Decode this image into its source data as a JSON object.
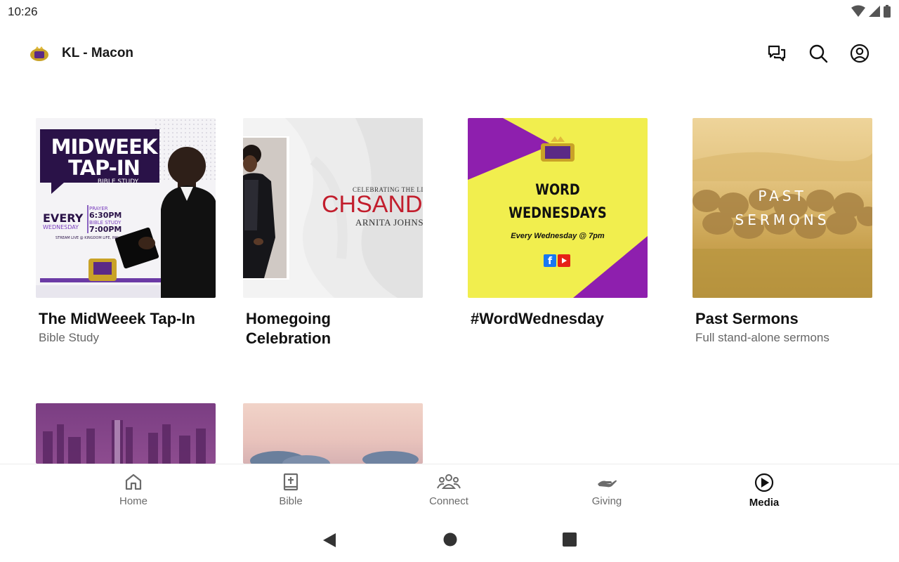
{
  "status": {
    "time": "10:26"
  },
  "app": {
    "title": "KL - Macon"
  },
  "cards": [
    {
      "title": "The MidWeeek Tap-In",
      "subtitle": "Bible Study",
      "art": {
        "headline1": "MIDWEEK",
        "headline2": "TAP-IN",
        "tag": "BIBLE STUDY",
        "every": "EVERY",
        "day": "WEDNESDAY",
        "prayer_label": "PRAYER",
        "prayer_time": "6:30PM",
        "study_label": "BIBLE STUDY",
        "study_time": "7:00PM",
        "stream": "STREAM LIVE @ KINGDOM LIFE, INC"
      }
    },
    {
      "title": "Homegoing Celebration",
      "subtitle": "",
      "art": {
        "line1": "CELEBRATING THE LIF",
        "big": "CHSAND",
        "name": "ARNITA JOHNSO"
      }
    },
    {
      "title": "#WordWednesday",
      "subtitle": "",
      "art": {
        "line1": "WORD",
        "line2": "WEDNESDAYS",
        "sched": "Every Wednesday @ 7pm"
      }
    },
    {
      "title": "Past Sermons",
      "subtitle": "Full stand-alone sermons",
      "art": {
        "line1": "PAST",
        "line2": "SERMONS"
      }
    }
  ],
  "nav": [
    {
      "label": "Home",
      "icon": "home-icon"
    },
    {
      "label": "Bible",
      "icon": "bible-icon"
    },
    {
      "label": "Connect",
      "icon": "people-icon"
    },
    {
      "label": "Giving",
      "icon": "giving-hand-icon"
    },
    {
      "label": "Media",
      "icon": "play-circle-icon",
      "active": true
    }
  ],
  "colors": {
    "purple": "#8e1fae",
    "yellow": "#f1ee4e",
    "dark_purple": "#2b0f4a",
    "red": "#c21e2d",
    "sepia": "#d8b56a"
  }
}
